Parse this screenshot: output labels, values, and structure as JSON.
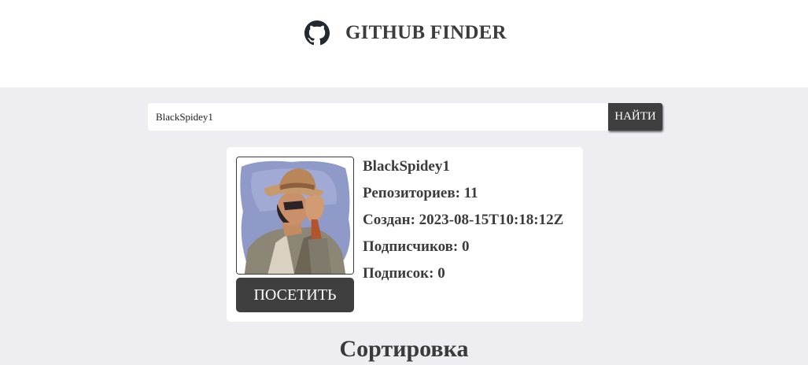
{
  "header": {
    "title": "GITHUB FINDER",
    "icon": "github-icon"
  },
  "search": {
    "value": "BlackSpidey1",
    "button_label": "НАЙТИ"
  },
  "profile": {
    "avatar_icon": "user-avatar-image",
    "login": "BlackSpidey1",
    "repos_label": "Репозиториев: 11",
    "created_label": "Создан: 2023-08-15T10:18:12Z",
    "followers_label": "Подписчиков: 0",
    "following_label": "Подписок: 0",
    "visit_label": "ПОСЕТИТЬ"
  },
  "sort": {
    "heading": "Сортировка"
  },
  "colors": {
    "page_background": "#ededf2",
    "header_background": "#ffffff",
    "button_background": "#3f3f3f",
    "text": "#3c3c3c"
  }
}
